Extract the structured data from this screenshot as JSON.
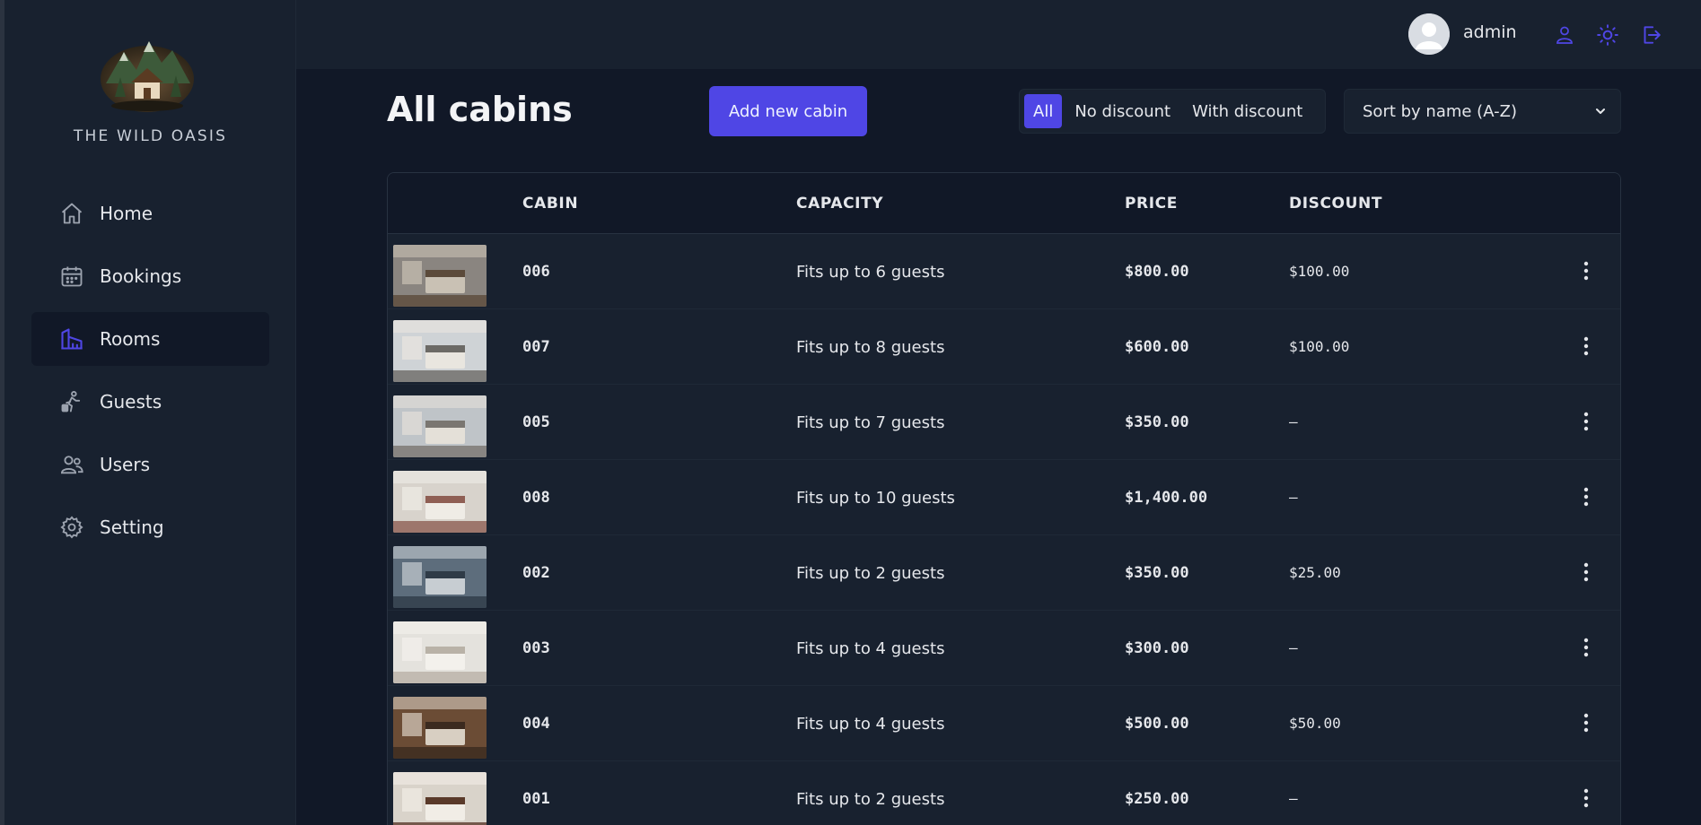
{
  "brand": {
    "name": "THE WILD OASIS"
  },
  "sidebar": {
    "items": [
      {
        "label": "Home",
        "icon": "home-icon",
        "active": false
      },
      {
        "label": "Bookings",
        "icon": "calendar-icon",
        "active": false
      },
      {
        "label": "Rooms",
        "icon": "building-icon",
        "active": true
      },
      {
        "label": "Guests",
        "icon": "guest-icon",
        "active": false
      },
      {
        "label": "Users",
        "icon": "users-icon",
        "active": false
      },
      {
        "label": "Setting",
        "icon": "gear-icon",
        "active": false
      }
    ]
  },
  "header": {
    "username": "admin",
    "icons": [
      "user-icon",
      "sun-icon",
      "logout-icon"
    ]
  },
  "main": {
    "title": "All cabins",
    "add_button": "Add new cabin",
    "filter": {
      "options": [
        "All",
        "No discount",
        "With discount"
      ],
      "selected": "All"
    },
    "sort": {
      "selected": "Sort by name (A-Z)"
    }
  },
  "table": {
    "columns": [
      "",
      "CABIN",
      "CAPACITY",
      "PRICE",
      "DISCOUNT",
      ""
    ],
    "rows": [
      {
        "cabin": "006",
        "capacity": "Fits up to 6 guests",
        "price": "$800.00",
        "discount": "$100.00"
      },
      {
        "cabin": "007",
        "capacity": "Fits up to 8 guests",
        "price": "$600.00",
        "discount": "$100.00"
      },
      {
        "cabin": "005",
        "capacity": "Fits up to 7 guests",
        "price": "$350.00",
        "discount": "—"
      },
      {
        "cabin": "008",
        "capacity": "Fits up to 10 guests",
        "price": "$1,400.00",
        "discount": "—"
      },
      {
        "cabin": "002",
        "capacity": "Fits up to 2 guests",
        "price": "$350.00",
        "discount": "$25.00"
      },
      {
        "cabin": "003",
        "capacity": "Fits up to 4 guests",
        "price": "$300.00",
        "discount": "—"
      },
      {
        "cabin": "004",
        "capacity": "Fits up to 4 guests",
        "price": "$500.00",
        "discount": "$50.00"
      },
      {
        "cabin": "001",
        "capacity": "Fits up to 2 guests",
        "price": "$250.00",
        "discount": "—"
      }
    ]
  },
  "colors": {
    "accent": "#4f46e5",
    "background": "#111827",
    "panel": "#18212f",
    "text": "#e5e7eb"
  }
}
